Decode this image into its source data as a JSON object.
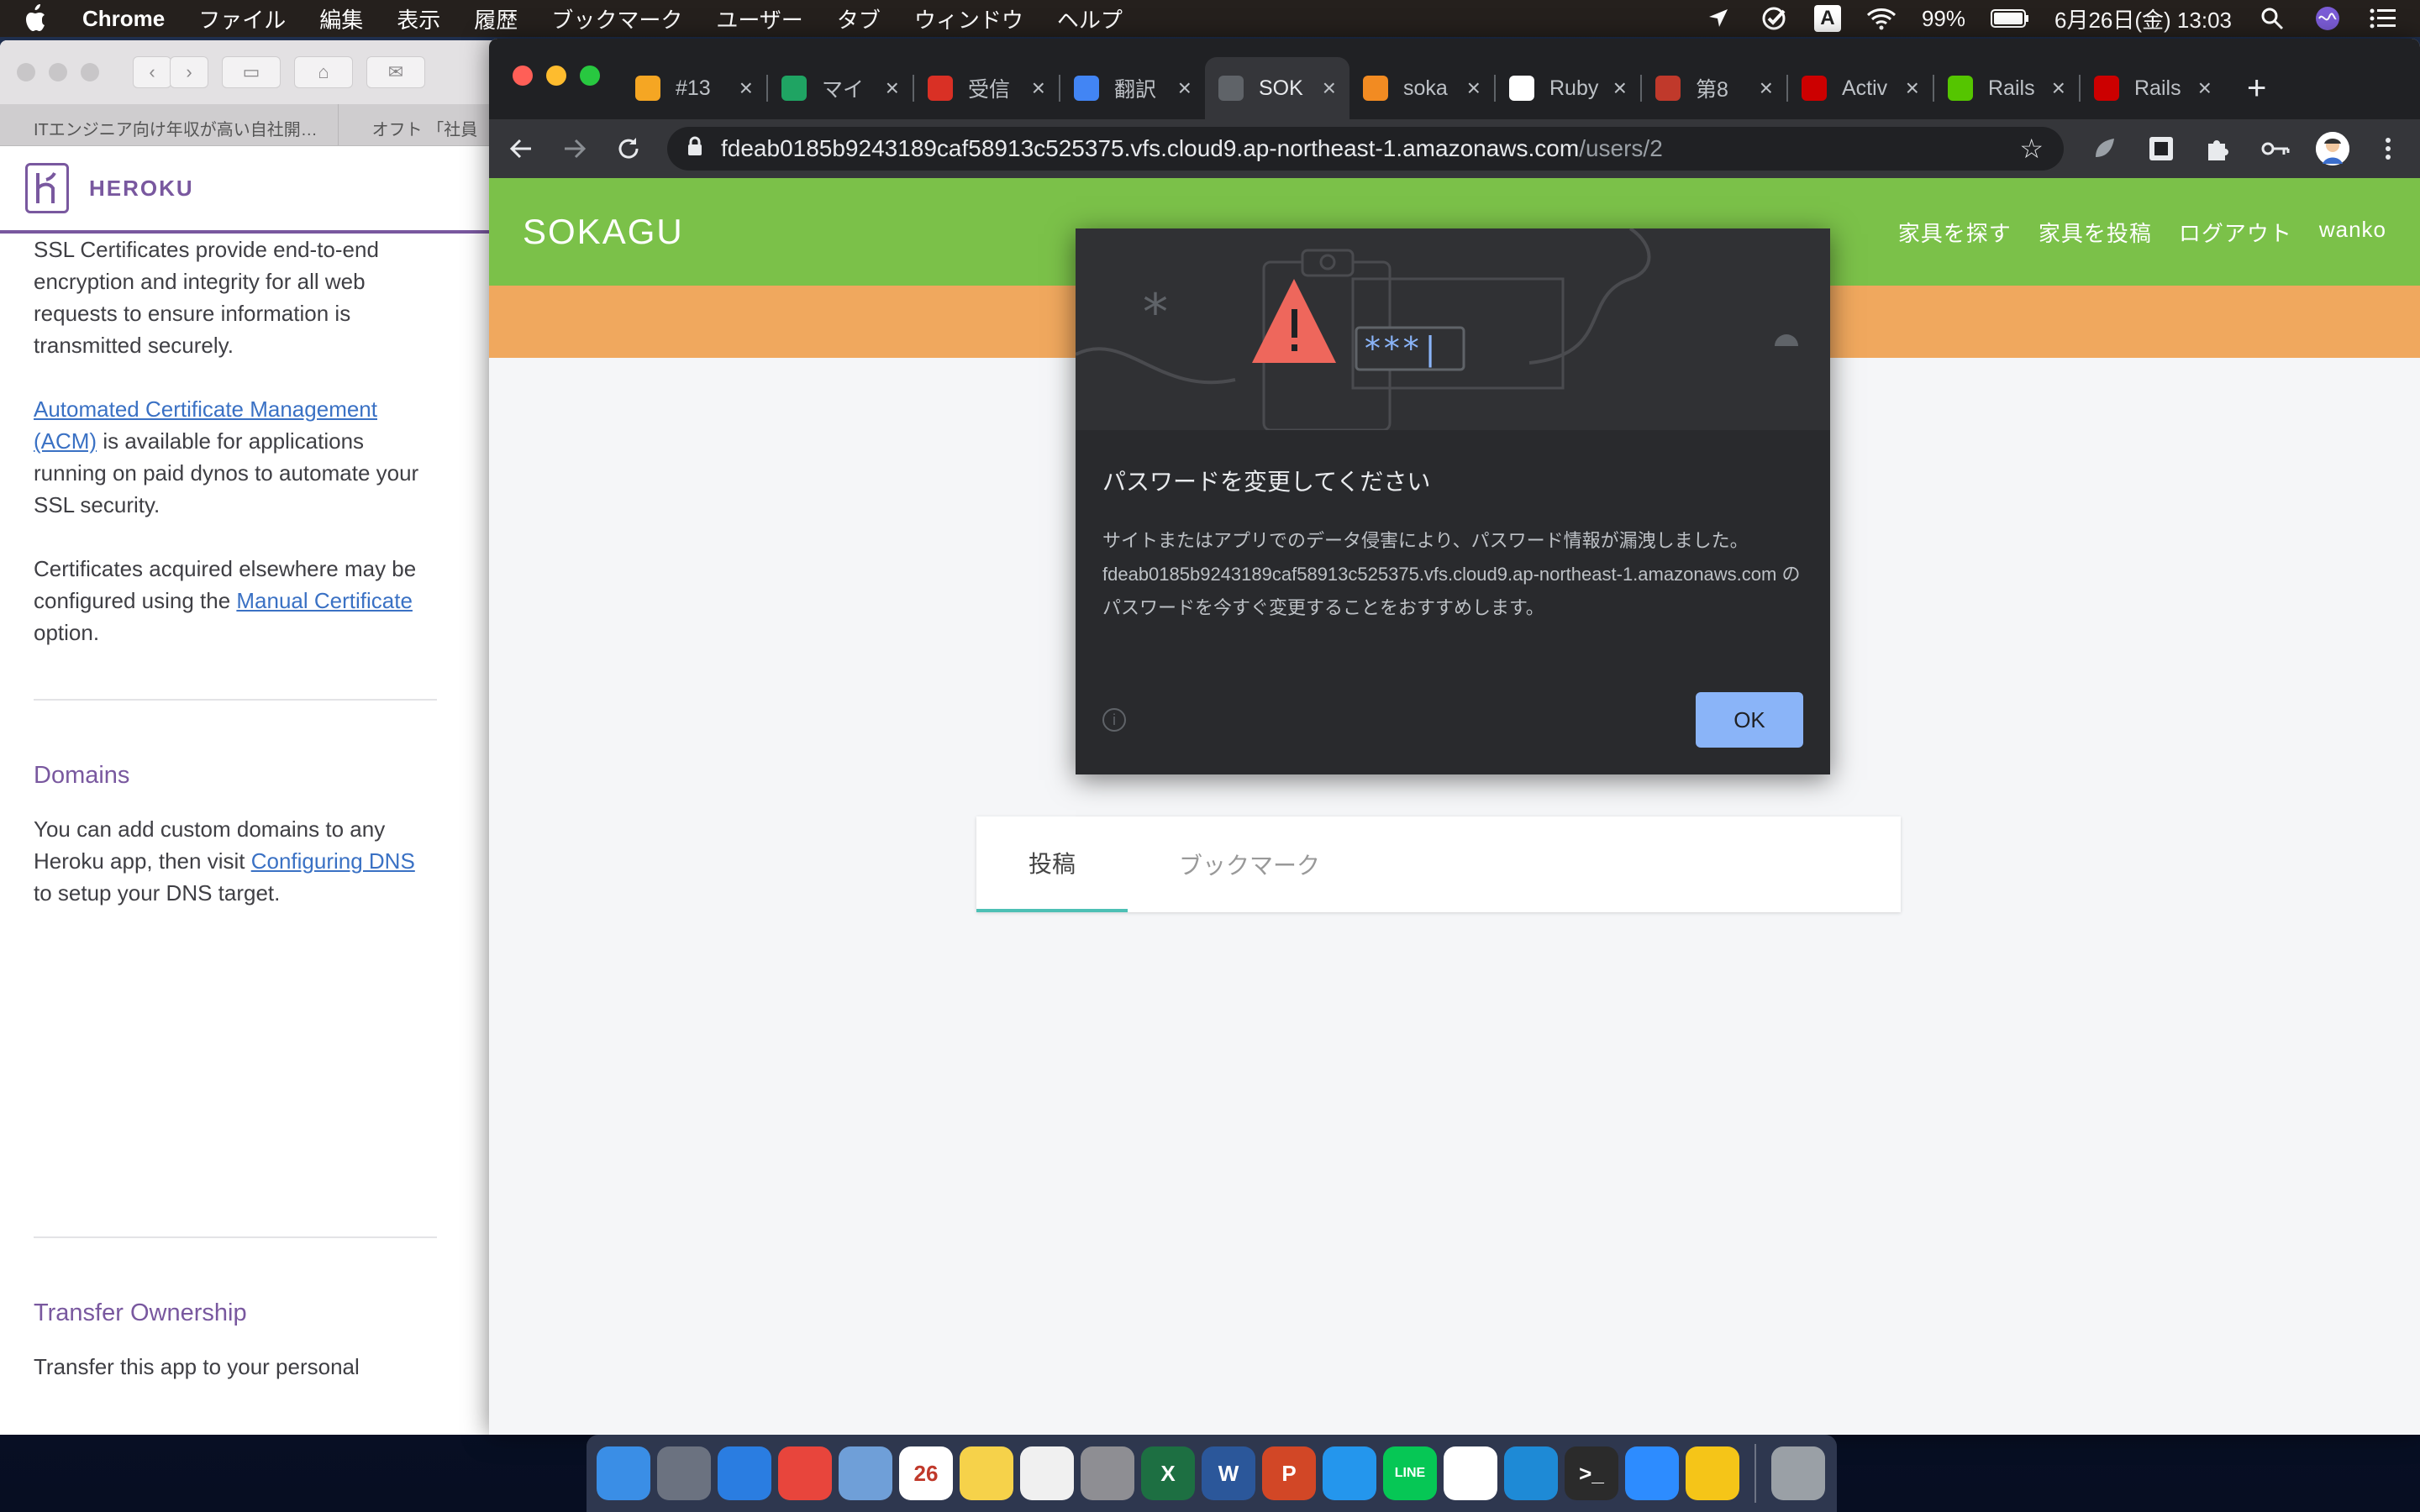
{
  "menubar": {
    "app": "Chrome",
    "menus": [
      "ファイル",
      "編集",
      "表示",
      "履歴",
      "ブックマーク",
      "ユーザー",
      "タブ",
      "ウィンドウ",
      "ヘルプ"
    ],
    "battery": "99%",
    "datetime": "6月26日(金)  13:03",
    "input_source": "A"
  },
  "safari": {
    "tabs": [
      "ITエンジニア向け年収が高い自社開…",
      "オフト 「社員"
    ],
    "site_name": "HEROKU",
    "ssl_text": "SSL Certificates provide end-to-end encryption and integrity for all web requests to ensure information is transmitted securely.",
    "acm_link": "Automated Certificate Management (ACM)",
    "acm_rest": " is available for applications running on paid dynos to automate your SSL security.",
    "cert_text": "Certificates acquired elsewhere may be configured using the ",
    "manual_link": "Manual Certificate",
    "cert_rest": " option.",
    "domains_heading": "Domains",
    "domains_text": "You can add custom domains to any Heroku app, then visit ",
    "dns_link": "Configuring DNS",
    "domains_rest": " to setup your DNS target.",
    "transfer_heading": "Transfer Ownership",
    "transfer_text": "Transfer this app to your personal"
  },
  "chrome": {
    "tabs": [
      {
        "title": "#13",
        "icon": "box-icon",
        "color": "#f5a623",
        "active": false
      },
      {
        "title": "マイ",
        "icon": "drive-icon",
        "color": "#1fa463",
        "active": false
      },
      {
        "title": "受信",
        "icon": "gmail-icon",
        "color": "#d93025",
        "active": false
      },
      {
        "title": "翻訳",
        "icon": "google-icon",
        "color": "#4285f4",
        "active": false
      },
      {
        "title": "SOK",
        "icon": "globe-icon",
        "color": "#5f6368",
        "active": true
      },
      {
        "title": "soka",
        "icon": "box-icon",
        "color": "#f28b22",
        "active": false
      },
      {
        "title": "Ruby",
        "icon": "p-icon",
        "color": "#ffffff",
        "active": false
      },
      {
        "title": "第8",
        "icon": "gear-icon",
        "color": "#c0392b",
        "active": false
      },
      {
        "title": "Activ",
        "icon": "rails-icon",
        "color": "#cc0000",
        "active": false
      },
      {
        "title": "Rails",
        "icon": "q-icon",
        "color": "#55c500",
        "active": false
      },
      {
        "title": "Rails",
        "icon": "rails-icon",
        "color": "#cc0000",
        "active": false
      }
    ],
    "url_host": "fdeab0185b9243189caf58913c525375.vfs.cloud9.ap-northeast-1.amazonaws.com",
    "url_path": "/users/2"
  },
  "site": {
    "brand": "SOKAGU",
    "nav": [
      "家具を探す",
      "家具を投稿",
      "ログアウト",
      "wanko"
    ],
    "tabs": [
      "投稿",
      "ブックマーク"
    ]
  },
  "dialog": {
    "illustration_text": "***|",
    "title": "パスワードを変更してください",
    "body": "サイトまたはアプリでのデータ侵害により、パスワード情報が漏洩しました。fdeab0185b9243189caf58913c525375.vfs.cloud9.ap-northeast-1.amazonaws.com のパスワードを今すぐ変更することをおすすめします。",
    "ok": "OK"
  },
  "dock": [
    {
      "name": "finder",
      "label": "",
      "color": "#3a8ee6"
    },
    {
      "name": "launchpad",
      "label": "",
      "color": "#6b7280"
    },
    {
      "name": "safari",
      "label": "",
      "color": "#2a7de1"
    },
    {
      "name": "chrome",
      "label": "",
      "color": "#e8453c"
    },
    {
      "name": "mail",
      "label": "",
      "color": "#6f9fd8"
    },
    {
      "name": "calendar",
      "label": "26",
      "color": "#ffffff"
    },
    {
      "name": "notes",
      "label": "",
      "color": "#f6d24a"
    },
    {
      "name": "photos",
      "label": "",
      "color": "#f0f0f0"
    },
    {
      "name": "system-preferences",
      "label": "",
      "color": "#8e8e93"
    },
    {
      "name": "excel",
      "label": "X",
      "color": "#1d6f42"
    },
    {
      "name": "word",
      "label": "W",
      "color": "#2b579a"
    },
    {
      "name": "powerpoint",
      "label": "P",
      "color": "#d24726"
    },
    {
      "name": "docker",
      "label": "",
      "color": "#2496ed"
    },
    {
      "name": "line",
      "label": "LINE",
      "color": "#06c755"
    },
    {
      "name": "slack",
      "label": "",
      "color": "#ffffff"
    },
    {
      "name": "vscode",
      "label": "",
      "color": "#1e8ad6"
    },
    {
      "name": "terminal",
      "label": ">_",
      "color": "#2b2b2b"
    },
    {
      "name": "zoom",
      "label": "",
      "color": "#2d8cff"
    },
    {
      "name": "cyberduck",
      "label": "",
      "color": "#f5c518"
    },
    {
      "name": "trash",
      "label": "",
      "color": "#9aa0a6"
    }
  ]
}
